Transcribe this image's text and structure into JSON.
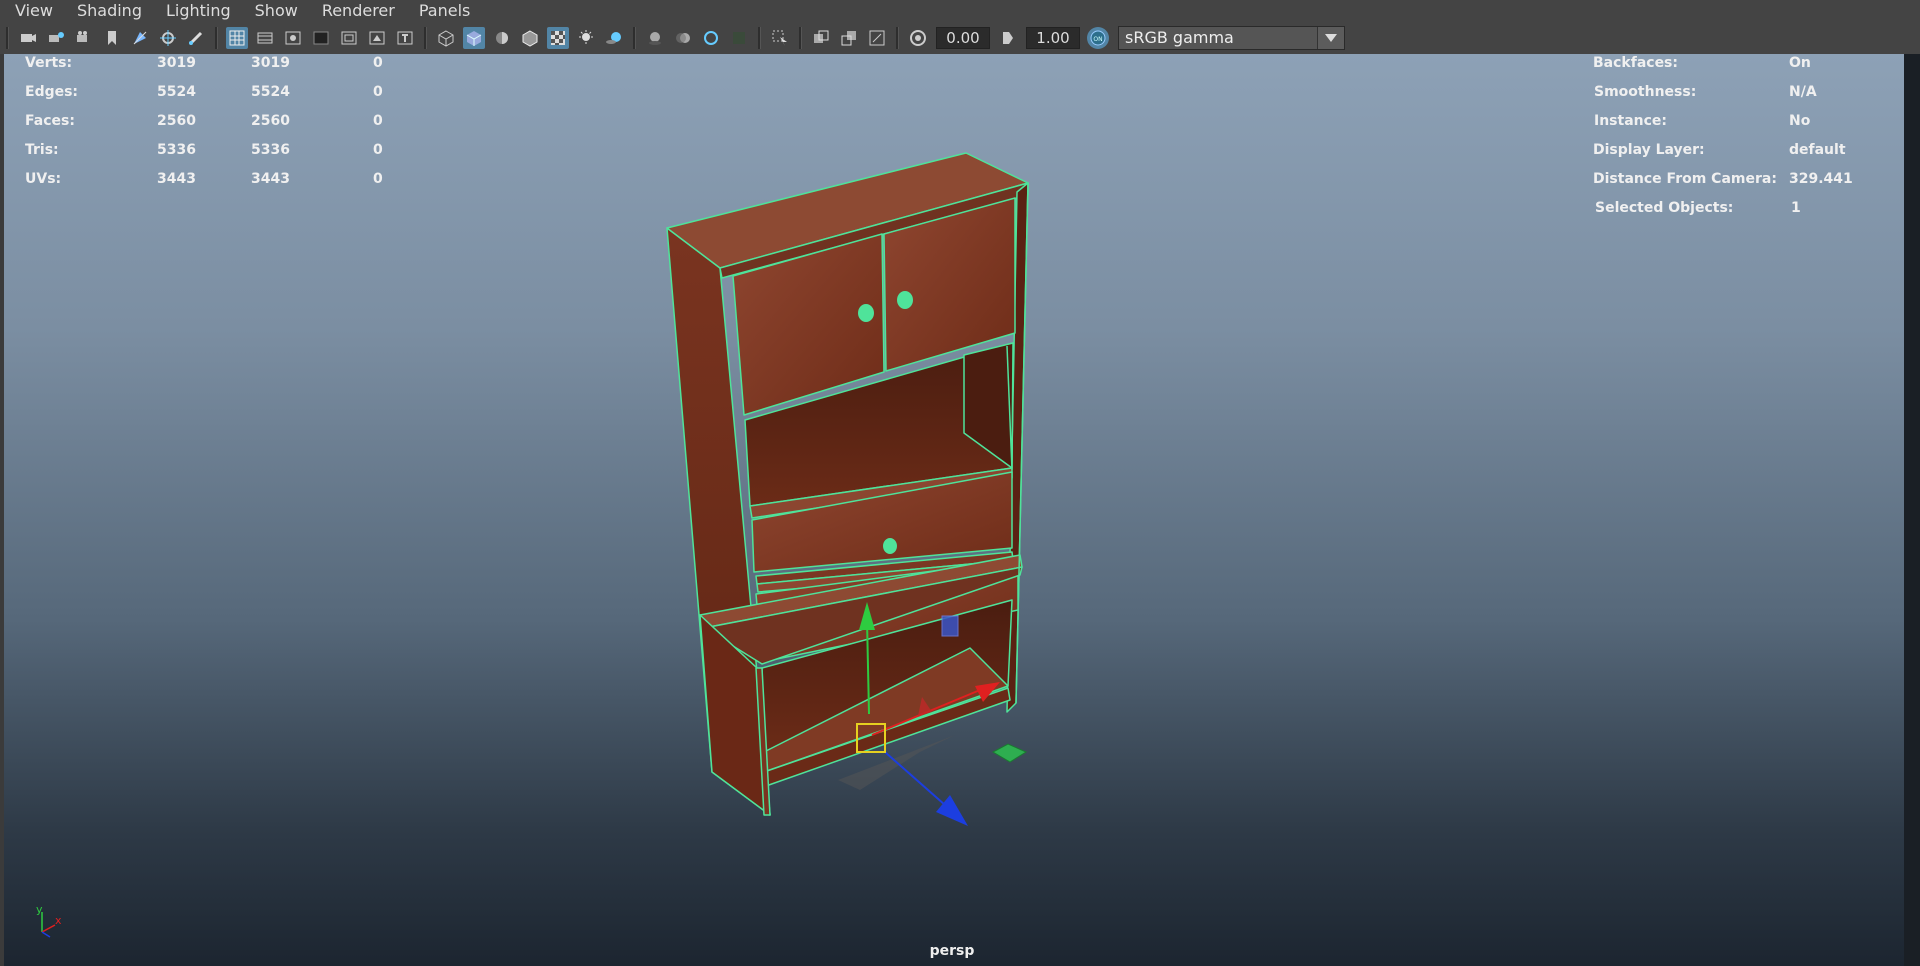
{
  "menus": [
    "View",
    "Shading",
    "Lighting",
    "Show",
    "Renderer",
    "Panels"
  ],
  "toolbar": {
    "exposure": "0.00",
    "gamma": "1.00",
    "colorspace": "sRGB gamma"
  },
  "stats_left": [
    {
      "label": "Verts:",
      "a": "3019",
      "b": "3019",
      "c": "0"
    },
    {
      "label": "Edges:",
      "a": "5524",
      "b": "5524",
      "c": "0"
    },
    {
      "label": "Faces:",
      "a": "2560",
      "b": "2560",
      "c": "0"
    },
    {
      "label": "Tris:",
      "a": "5336",
      "b": "5336",
      "c": "0"
    },
    {
      "label": "UVs:",
      "a": "3443",
      "b": "3443",
      "c": "0"
    }
  ],
  "stats_right": [
    {
      "label": "Backfaces:",
      "value": "On"
    },
    {
      "label": "Smoothness:",
      "value": "N/A"
    },
    {
      "label": "Instance:",
      "value": "No"
    },
    {
      "label": "Display Layer:",
      "value": "default"
    },
    {
      "label": "Distance From Camera:",
      "value": "329.441"
    },
    {
      "label": "Selected Objects:",
      "value": "1"
    }
  ],
  "camera": "persp",
  "axis": {
    "y": "y",
    "x": "x"
  },
  "colors": {
    "wood": "#7a3420",
    "wood_light": "#8f4630",
    "selection": "#4fe39a",
    "gizmo_y": "#2ecc40",
    "gizmo_x": "#e02020",
    "gizmo_z": "#1c3ee0",
    "pivot": "#e6d020"
  }
}
